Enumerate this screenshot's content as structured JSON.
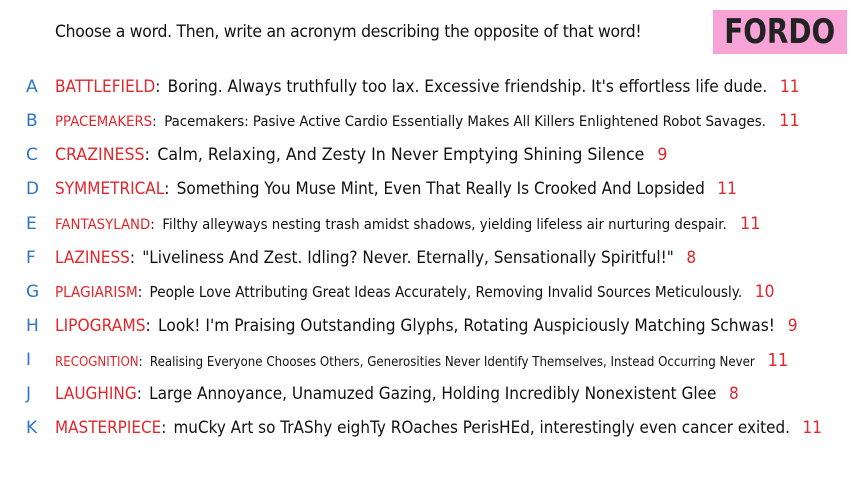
{
  "prompt": "Choose a word. Then, write an acronym describing the opposite of that word!",
  "brand": "FORDO",
  "colors": {
    "letter": "#2f74c8",
    "word": "#e3262c",
    "brand_bg": "#f7a3d8"
  },
  "rows": [
    {
      "letter": "A",
      "word": "BATTLEFIELD",
      "text": "Boring. Always truthfully too lax. Excessive friendship. It's effortless life dude.",
      "count": "11"
    },
    {
      "letter": "B",
      "word": "PPACEMAKERS",
      "text": "Pacemakers: Pasive Active Cardio Essentially Makes All Killers Enlightened Robot Savages.",
      "count": "11"
    },
    {
      "letter": "C",
      "word": "CRAZINESS",
      "text": "Calm, Relaxing, And Zesty In Never Emptying Shining Silence",
      "count": "9"
    },
    {
      "letter": "D",
      "word": "SYMMETRICAL",
      "text": "Something You Muse Mint, Even That Really Is Crooked And Lopsided",
      "count": "11"
    },
    {
      "letter": "E",
      "word": "FANTASYLAND",
      "text": "Filthy alleyways nesting trash amidst shadows, yielding lifeless air nurturing despair.",
      "count": "11"
    },
    {
      "letter": "F",
      "word": "LAZINESS",
      "text": "\"Liveliness And Zest. Idling? Never. Eternally, Sensationally Spiritful!\"",
      "count": "8"
    },
    {
      "letter": "G",
      "word": "PLAGIARISM",
      "text": "People Love Attributing Great Ideas Accurately, Removing Invalid Sources Meticulously.",
      "count": "10"
    },
    {
      "letter": "H",
      "word": "LIPOGRAMS",
      "text": "Look! I'm Praising Outstanding Glyphs, Rotating Auspiciously Matching Schwas!",
      "count": "9"
    },
    {
      "letter": "I",
      "word": "RECOGNITION",
      "text": "Realising Everyone Chooses Others, Generosities Never Identify Themselves, Instead Occurring Never",
      "count": "11"
    },
    {
      "letter": "J",
      "word": "LAUGHING",
      "text": "Large Annoyance, Unamuzed Gazing, Holding Incredibly Nonexistent Glee",
      "count": "8"
    },
    {
      "letter": "K",
      "word": "MASTERPIECE",
      "text": "muCky Art so TrAShy eighTy ROaches PerisHEd, interestingly even cancer exited.",
      "count": "11"
    }
  ]
}
